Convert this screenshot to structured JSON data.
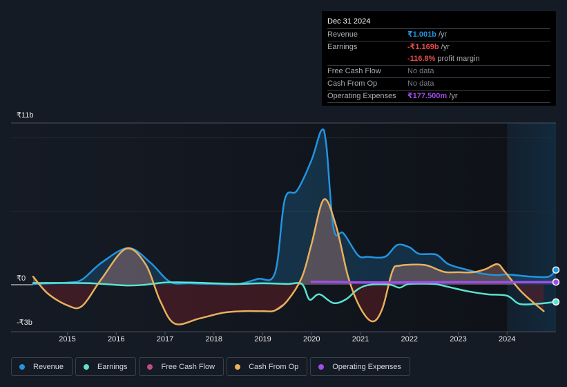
{
  "tooltip": {
    "date": "Dec 31 2024",
    "rows": [
      {
        "label": "Revenue",
        "value": "₹1.001b",
        "suffix": " /yr",
        "color": "#2394df"
      },
      {
        "label": "Earnings",
        "value": "-₹1.169b",
        "suffix": " /yr",
        "color": "#e64b4b"
      },
      {
        "label": "",
        "value": "-116.8%",
        "suffix": " profit margin",
        "color": "#e64b4b"
      },
      {
        "label": "Free Cash Flow",
        "value": "",
        "suffix": "No data",
        "color": "#7a7e84"
      },
      {
        "label": "Cash From Op",
        "value": "",
        "suffix": "No data",
        "color": "#7a7e84"
      },
      {
        "label": "Operating Expenses",
        "value": "₹177.500m",
        "suffix": " /yr",
        "color": "#a24de8"
      }
    ]
  },
  "legend": [
    {
      "label": "Revenue",
      "color": "#2394df"
    },
    {
      "label": "Earnings",
      "color": "#5be3cf"
    },
    {
      "label": "Free Cash Flow",
      "color": "#c14b8a"
    },
    {
      "label": "Cash From Op",
      "color": "#e9b05d"
    },
    {
      "label": "Operating Expenses",
      "color": "#a24de8"
    }
  ],
  "chart_data": {
    "type": "area",
    "title": "",
    "xlabel": "",
    "ylabel": "",
    "currency": "INR",
    "ylim": [
      -3,
      11
    ],
    "xlim": [
      2014.3,
      2025.0
    ],
    "forecast_start": 2024.0,
    "y_tick_labels": [
      {
        "value": 11,
        "label": "₹11b"
      },
      {
        "value": 0,
        "label": "₹0"
      },
      {
        "value": -3,
        "label": "-₹3b"
      }
    ],
    "x_tick_labels": [
      "2015",
      "2016",
      "2017",
      "2018",
      "2019",
      "2020",
      "2021",
      "2022",
      "2023",
      "2024"
    ],
    "x_ticks": [
      2015,
      2016,
      2017,
      2018,
      2019,
      2020,
      2021,
      2022,
      2023,
      2024
    ],
    "grid_values": [
      10,
      5
    ],
    "series": [
      {
        "name": "Revenue",
        "color": "#2394df",
        "points": [
          [
            2014.3,
            0.05
          ],
          [
            2015.0,
            0.15
          ],
          [
            2015.3,
            0.35
          ],
          [
            2015.7,
            1.5
          ],
          [
            2016.25,
            2.5
          ],
          [
            2016.7,
            1.5
          ],
          [
            2017.1,
            0.2
          ],
          [
            2017.5,
            0.1
          ],
          [
            2018.0,
            0.05
          ],
          [
            2018.5,
            0.05
          ],
          [
            2018.9,
            0.4
          ],
          [
            2019.25,
            0.8
          ],
          [
            2019.45,
            5.8
          ],
          [
            2019.7,
            6.4
          ],
          [
            2020.0,
            8.5
          ],
          [
            2020.2,
            10.5
          ],
          [
            2020.3,
            9.5
          ],
          [
            2020.45,
            3.8
          ],
          [
            2020.65,
            3.5
          ],
          [
            2020.95,
            2.0
          ],
          [
            2021.15,
            1.9
          ],
          [
            2021.5,
            1.9
          ],
          [
            2021.75,
            2.7
          ],
          [
            2022.0,
            2.55
          ],
          [
            2022.2,
            2.1
          ],
          [
            2022.55,
            2.05
          ],
          [
            2022.8,
            1.4
          ],
          [
            2023.2,
            1.0
          ],
          [
            2023.5,
            0.75
          ],
          [
            2023.8,
            0.65
          ],
          [
            2024.0,
            0.7
          ],
          [
            2024.5,
            0.55
          ],
          [
            2024.85,
            0.55
          ],
          [
            2025.0,
            1.0
          ]
        ]
      },
      {
        "name": "Earnings",
        "color": "#5be3cf",
        "points": [
          [
            2014.3,
            0.12
          ],
          [
            2015.0,
            0.12
          ],
          [
            2015.5,
            0.1
          ],
          [
            2016.2,
            -0.05
          ],
          [
            2016.6,
            0.0
          ],
          [
            2017.0,
            0.15
          ],
          [
            2017.5,
            0.15
          ],
          [
            2018.0,
            0.1
          ],
          [
            2018.5,
            0.05
          ],
          [
            2019.0,
            0.1
          ],
          [
            2019.5,
            0.05
          ],
          [
            2019.8,
            0.05
          ],
          [
            2019.95,
            -1.0
          ],
          [
            2020.1,
            -0.7
          ],
          [
            2020.2,
            -0.7
          ],
          [
            2020.45,
            -1.25
          ],
          [
            2020.7,
            -1.0
          ],
          [
            2020.95,
            -0.3
          ],
          [
            2021.2,
            0.0
          ],
          [
            2021.6,
            0.0
          ],
          [
            2021.8,
            -0.2
          ],
          [
            2022.0,
            0.05
          ],
          [
            2022.5,
            0.05
          ],
          [
            2022.8,
            -0.15
          ],
          [
            2023.2,
            -0.45
          ],
          [
            2023.6,
            -0.65
          ],
          [
            2024.0,
            -0.75
          ],
          [
            2024.25,
            -1.3
          ],
          [
            2024.6,
            -1.3
          ],
          [
            2025.0,
            -1.17
          ]
        ]
      },
      {
        "name": "Free Cash Flow",
        "color": "#c14b8a",
        "points": [
          [
            2019.25,
            -1.75
          ],
          [
            2019.4,
            -1.4
          ]
        ]
      },
      {
        "name": "Cash From Op",
        "color": "#e9b05d",
        "points": [
          [
            2014.3,
            0.55
          ],
          [
            2014.6,
            -0.6
          ],
          [
            2015.0,
            -1.4
          ],
          [
            2015.3,
            -1.45
          ],
          [
            2015.7,
            0.4
          ],
          [
            2016.2,
            2.45
          ],
          [
            2016.6,
            1.4
          ],
          [
            2016.9,
            -1.1
          ],
          [
            2017.2,
            -2.65
          ],
          [
            2017.7,
            -2.3
          ],
          [
            2018.2,
            -1.9
          ],
          [
            2018.6,
            -1.8
          ],
          [
            2019.0,
            -1.8
          ],
          [
            2019.25,
            -1.75
          ],
          [
            2019.5,
            -1.1
          ],
          [
            2019.8,
            0.5
          ],
          [
            2020.0,
            2.8
          ],
          [
            2020.25,
            5.8
          ],
          [
            2020.5,
            4.0
          ],
          [
            2020.75,
            0.5
          ],
          [
            2021.0,
            -1.6
          ],
          [
            2021.25,
            -2.5
          ],
          [
            2021.45,
            -1.6
          ],
          [
            2021.65,
            0.9
          ],
          [
            2021.8,
            1.3
          ],
          [
            2022.3,
            1.35
          ],
          [
            2022.6,
            1.0
          ],
          [
            2022.75,
            0.85
          ],
          [
            2023.0,
            0.85
          ],
          [
            2023.3,
            0.85
          ],
          [
            2023.55,
            1.05
          ],
          [
            2023.8,
            1.4
          ],
          [
            2023.95,
            0.9
          ],
          [
            2024.3,
            -0.5
          ],
          [
            2024.75,
            -1.8
          ]
        ]
      },
      {
        "name": "Operating Expenses",
        "color": "#a24de8",
        "points": [
          [
            2020.0,
            0.2
          ],
          [
            2020.5,
            0.18
          ],
          [
            2021.0,
            0.15
          ],
          [
            2022.0,
            0.16
          ],
          [
            2023.0,
            0.17
          ],
          [
            2024.0,
            0.17
          ],
          [
            2025.0,
            0.1775
          ]
        ]
      }
    ],
    "end_markers": [
      {
        "series": "Revenue",
        "value": 1.001
      },
      {
        "series": "Operating Expenses",
        "value": 0.1775
      },
      {
        "series": "Earnings",
        "value": -1.169
      }
    ]
  }
}
